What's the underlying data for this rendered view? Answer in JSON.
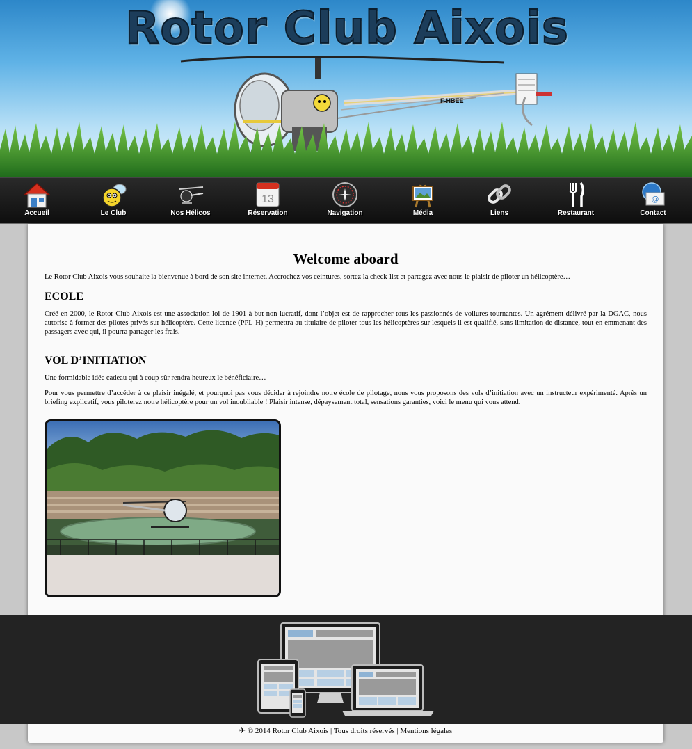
{
  "header": {
    "logo_text": "Rotor Club Aixois",
    "registration": "F-HBEE"
  },
  "nav": {
    "items": [
      {
        "label": "Accueil",
        "icon": "home-icon"
      },
      {
        "label": "Le Club",
        "icon": "bee-icon"
      },
      {
        "label": "Nos Hélicos",
        "icon": "helicopter-icon"
      },
      {
        "label": "Réservation",
        "icon": "calendar-icon",
        "calendar_day": "13"
      },
      {
        "label": "Navigation",
        "icon": "instrument-icon"
      },
      {
        "label": "Média",
        "icon": "easel-icon"
      },
      {
        "label": "Liens",
        "icon": "link-icon"
      },
      {
        "label": "Restaurant",
        "icon": "cutlery-icon"
      },
      {
        "label": "Contact",
        "icon": "email-icon",
        "badge": "@"
      }
    ]
  },
  "main": {
    "title": "Welcome aboard",
    "intro": "Le Rotor Club Aixois vous souhaite la bienvenue à bord de son site internet. Accrochez vos ceintures, sortez la check-list et partagez avec nous le plaisir de piloter un hélicoptère…",
    "sections": [
      {
        "heading": "ECOLE",
        "paragraphs": [
          "Créé en 2000, le Rotor Club Aixois est une association loi de 1901 à but non lucratif, dont l’objet est de rapprocher tous les passionnés de voilures tournantes. Un agrément délivré par la DGAC, nous autorise à former des pilotes privés sur hélicoptère. Cette licence (PPL-H) permettra au titulaire de piloter tous les hélicoptères sur lesquels il est qualifié, sans limitation de distance, tout en emmenant des passagers avec qui, il pourra partager les frais."
        ]
      },
      {
        "heading": "VOL D’INITIATION",
        "paragraphs": [
          "Une formidable idée cadeau qui à coup sûr rendra heureux le bénéficiaire…",
          "Pour vous permettre d’accéder à ce plaisir inégalé, et pourquoi pas vous décider à rejoindre notre école de pilotage, nous vous proposons des vols d’initiation avec un instructeur expérimenté. Après un briefing explicatif, vous piloterez notre hélicoptère pour un vol inoubliable ! Plaisir intense, dépaysement total, sensations garanties, voici le menu qui vous attend."
        ]
      }
    ]
  },
  "footer": {
    "plane_glyph": "✈",
    "copyright": "© 2014 Rotor Club Aixois",
    "sep1": "|",
    "rights": "Tous droits réservés",
    "sep2": "|",
    "legal": "Mentions légales"
  },
  "colors": {
    "nav_background": "#1a1a1a",
    "footer_band": "#232323",
    "page_background": "#fafafa",
    "body_background": "#c8c8c8"
  }
}
